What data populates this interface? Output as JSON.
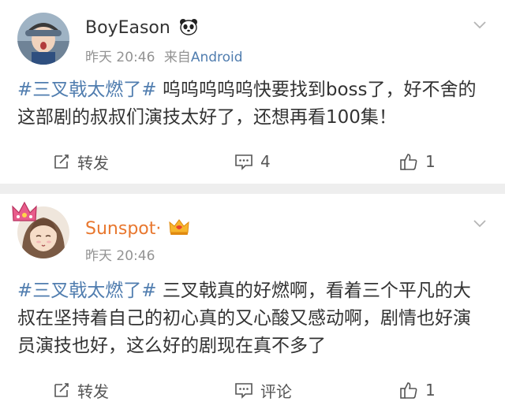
{
  "posts": [
    {
      "user": {
        "name": "BoyEason",
        "badge": "panda-icon"
      },
      "time": "昨天 20:46",
      "source_prefix": "来自",
      "source": "Android",
      "hashtag": "#三叉戟太燃了#",
      "text": " 呜呜呜呜呜快要找到boss了，好不舍的这部剧的叔叔们演技太好了，还想再看100集！",
      "actions": {
        "repost": "转发",
        "comment": "4",
        "like": "1"
      }
    },
    {
      "user": {
        "name": "Sunspot·",
        "badge": "crown-icon"
      },
      "time": "昨天 20:46",
      "hashtag": "#三叉戟太燃了#",
      "text": " 三叉戟真的好燃啊，看着三个平凡的大叔在坚持着自己的初心真的又心酸又感动啊，剧情也好演员演技也好，这么好的剧现在真不多了",
      "actions": {
        "repost": "转发",
        "comment": "评论",
        "like": "1"
      }
    }
  ],
  "colors": {
    "link": "#507daf",
    "vip_name": "#e8772e",
    "meta": "#939393",
    "divider": "#eeeeee"
  }
}
